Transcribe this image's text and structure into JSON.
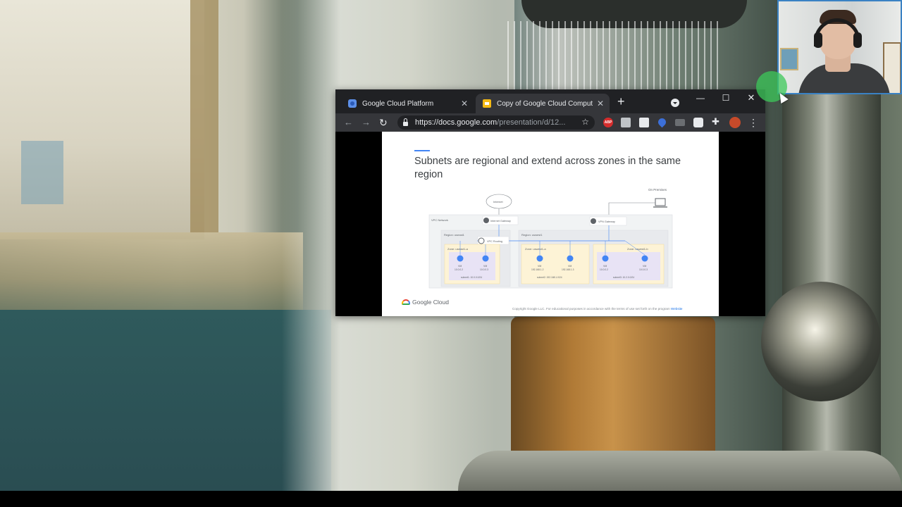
{
  "browser": {
    "tabs": [
      {
        "title": "Google Cloud Platform",
        "active": false,
        "icon": "gcp-icon"
      },
      {
        "title": "Copy of Google Cloud Computin",
        "active": true,
        "icon": "slides-icon"
      }
    ],
    "new_tab_glyph": "+",
    "window_controls": {
      "minimize": "—",
      "maximize": "☐",
      "close": "✕"
    },
    "nav": {
      "back": "←",
      "forward": "→",
      "reload": "↻"
    },
    "url_host": "https://docs.google.com",
    "url_path": "/presentation/d/12...",
    "bookmark_glyph": "☆",
    "menu_glyph": "⋮",
    "extensions": [
      "abp-icon",
      "extension-icon",
      "extension-icon",
      "extension-icon",
      "extension-icon",
      "extension-icon",
      "puzzle-icon"
    ],
    "abp_label": "ABP"
  },
  "slide": {
    "title": "Subnets are regional and extend across zones in the same region",
    "diagram": {
      "on_premises": "On Premises",
      "internet": "Internet",
      "internet_gateway": "Internet Gateway",
      "vpn_gateway": "VPN Gateway",
      "vpc_network": "VPC Network",
      "vpc_routing": "VPC Routing",
      "regions": [
        {
          "label": "Region: useast1",
          "zones": [
            {
              "label": "Zone: useast1-a",
              "vms": [
                {
                  "name": "VM",
                  "ip": "10.0.0.2"
                },
                {
                  "name": "VM",
                  "ip": "10.0.0.3"
                }
              ],
              "subnet": "subnet1: 10.0.0.0/24"
            }
          ]
        },
        {
          "label": "Region: uswest1",
          "zones": [
            {
              "label": "Zone: uswest1-a",
              "vms": [
                {
                  "name": "VM",
                  "ip": "192.168.1.2"
                },
                {
                  "name": "VM",
                  "ip": "192.168.1.3"
                }
              ],
              "subnet": "subnet2: 192.168.1.0/24"
            },
            {
              "label": "Zone: uswest1-b",
              "vms": [
                {
                  "name": "VM",
                  "ip": "10.0.0.2"
                },
                {
                  "name": "VM",
                  "ip": "10.0.0.3"
                }
              ],
              "subnet": "subnet3: 10.2.0.0/24"
            }
          ]
        }
      ]
    },
    "logo_text": "Google Cloud",
    "copyright": "Copyright Google LLC. For educational purposes in accordance with the terms of use set forth on the program",
    "copyright_link": "Website"
  },
  "colors": {
    "accent": "#4285f4",
    "tab_active": "#35363a",
    "titlebar": "#202124",
    "webcam_border": "#3a82c4"
  }
}
